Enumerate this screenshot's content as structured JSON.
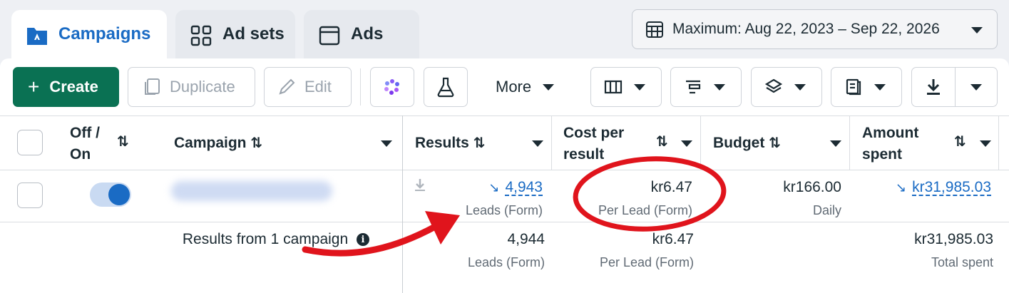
{
  "tabs": [
    {
      "label": "Campaigns",
      "icon": "campaigns-folder-icon",
      "active": true
    },
    {
      "label": "Ad sets",
      "icon": "grid-icon",
      "active": false
    },
    {
      "label": "Ads",
      "icon": "window-icon",
      "active": false
    }
  ],
  "date_range": {
    "label": "Maximum: Aug 22, 2023 – Sep 22, 2026",
    "icon": "calendar-icon"
  },
  "toolbar": {
    "create": "Create",
    "duplicate": "Duplicate",
    "edit": "Edit",
    "more": "More"
  },
  "table": {
    "headers": {
      "off_on": "Off /\nOn",
      "campaign": "Campaign",
      "results": "Results",
      "cost_per_result": "Cost per\nresult",
      "budget": "Budget",
      "amount_spent": "Amount\nspent"
    },
    "row": {
      "campaign_name": "",
      "toggle_on": true,
      "results": "4,943",
      "results_sub": "Leads (Form)",
      "cost": "kr6.47",
      "cost_sub": "Per Lead (Form)",
      "budget": "kr166.00",
      "budget_sub": "Daily",
      "spent": "kr31,985.03"
    },
    "summary": {
      "label": "Results from 1 campaign",
      "results": "4,944",
      "results_sub": "Leads (Form)",
      "cost": "kr6.47",
      "cost_sub": "Per Lead (Form)",
      "spent": "kr31,985.03",
      "spent_sub": "Total spent"
    }
  },
  "colors": {
    "accent": "#1a6bc4",
    "create": "#0a7153",
    "annotation": "#e0141c"
  }
}
